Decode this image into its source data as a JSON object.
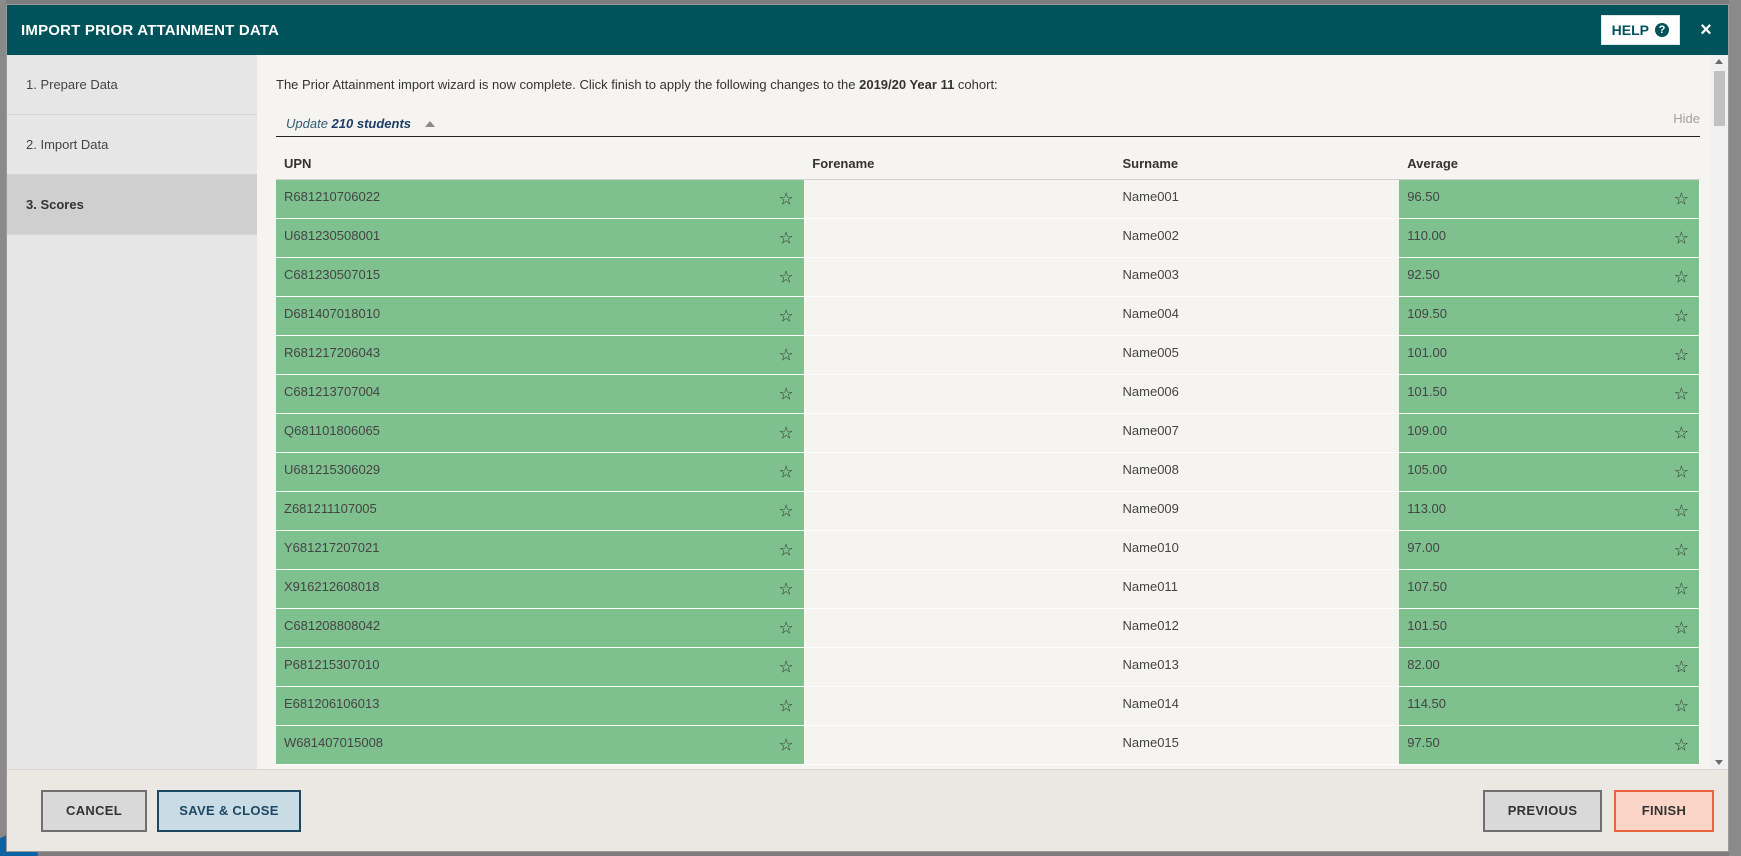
{
  "modal": {
    "title": "IMPORT PRIOR ATTAINMENT DATA",
    "help_label": "HELP",
    "help_icon": "?",
    "close_icon": "×"
  },
  "steps": [
    {
      "label": "1. Prepare Data"
    },
    {
      "label": "2. Import Data"
    },
    {
      "label": "3. Scores",
      "active": true
    }
  ],
  "intro": {
    "text_before": "The Prior Attainment import wizard is now complete. Click finish to apply the following changes to the ",
    "cohort": "2019/20 Year 11",
    "text_after": " cohort:"
  },
  "update": {
    "prefix": "Update",
    "count": "210 students",
    "hide_label": "Hide"
  },
  "table": {
    "columns": [
      "UPN",
      "Forename",
      "Surname",
      "Average"
    ],
    "rows": [
      {
        "upn": "R681210706022",
        "forename": "",
        "surname": "Name001",
        "average": "96.50"
      },
      {
        "upn": "U681230508001",
        "forename": "",
        "surname": "Name002",
        "average": "110.00"
      },
      {
        "upn": "C681230507015",
        "forename": "",
        "surname": "Name003",
        "average": "92.50"
      },
      {
        "upn": "D681407018010",
        "forename": "",
        "surname": "Name004",
        "average": "109.50"
      },
      {
        "upn": "R681217206043",
        "forename": "",
        "surname": "Name005",
        "average": "101.00"
      },
      {
        "upn": "C681213707004",
        "forename": "",
        "surname": "Name006",
        "average": "101.50"
      },
      {
        "upn": "Q681101806065",
        "forename": "",
        "surname": "Name007",
        "average": "109.00"
      },
      {
        "upn": "U681215306029",
        "forename": "",
        "surname": "Name008",
        "average": "105.00"
      },
      {
        "upn": "Z681211107005",
        "forename": "",
        "surname": "Name009",
        "average": "113.00"
      },
      {
        "upn": "Y681217207021",
        "forename": "",
        "surname": "Name010",
        "average": "97.00"
      },
      {
        "upn": "X916212608018",
        "forename": "",
        "surname": "Name011",
        "average": "107.50"
      },
      {
        "upn": "C681208808042",
        "forename": "",
        "surname": "Name012",
        "average": "101.50"
      },
      {
        "upn": "P681215307010",
        "forename": "",
        "surname": "Name013",
        "average": "82.00"
      },
      {
        "upn": "E681206106013",
        "forename": "",
        "surname": "Name014",
        "average": "114.50"
      },
      {
        "upn": "W681407015008",
        "forename": "",
        "surname": "Name015",
        "average": "97.50"
      }
    ],
    "star_icon": "☆"
  },
  "footer": {
    "cancel_label": "CANCEL",
    "save_close_label": "SAVE & CLOSE",
    "previous_label": "PREVIOUS",
    "finish_label": "FINISH"
  },
  "colors": {
    "header": "#00535b",
    "highlight": "#7fc08f",
    "finish_border": "#e9643d"
  }
}
